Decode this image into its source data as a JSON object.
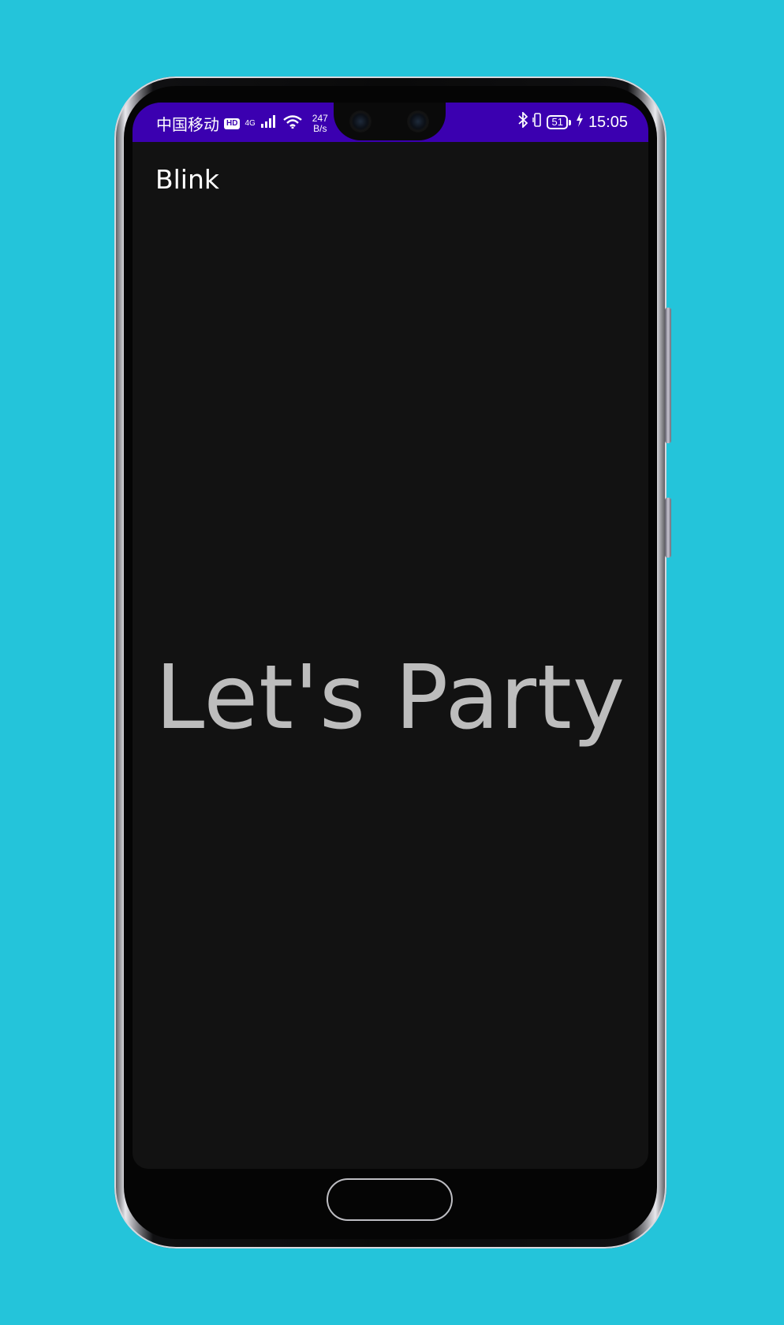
{
  "status_bar": {
    "carrier": "中国移动",
    "hd_badge": "HD",
    "network_type": "4G",
    "net_speed_value": "247",
    "net_speed_unit": "B/s",
    "battery_level": "51",
    "time": "15:05",
    "background_color": "#3B00B0",
    "icons": [
      "signal-icon",
      "wifi-icon",
      "bluetooth-icon",
      "vibrate-icon",
      "battery-icon",
      "charging-icon"
    ]
  },
  "app": {
    "title": "Blink",
    "main_text": "Let's Party",
    "background_color": "#121212",
    "text_color": "#bdbdbd"
  },
  "page": {
    "background_color": "#24C4DA"
  }
}
